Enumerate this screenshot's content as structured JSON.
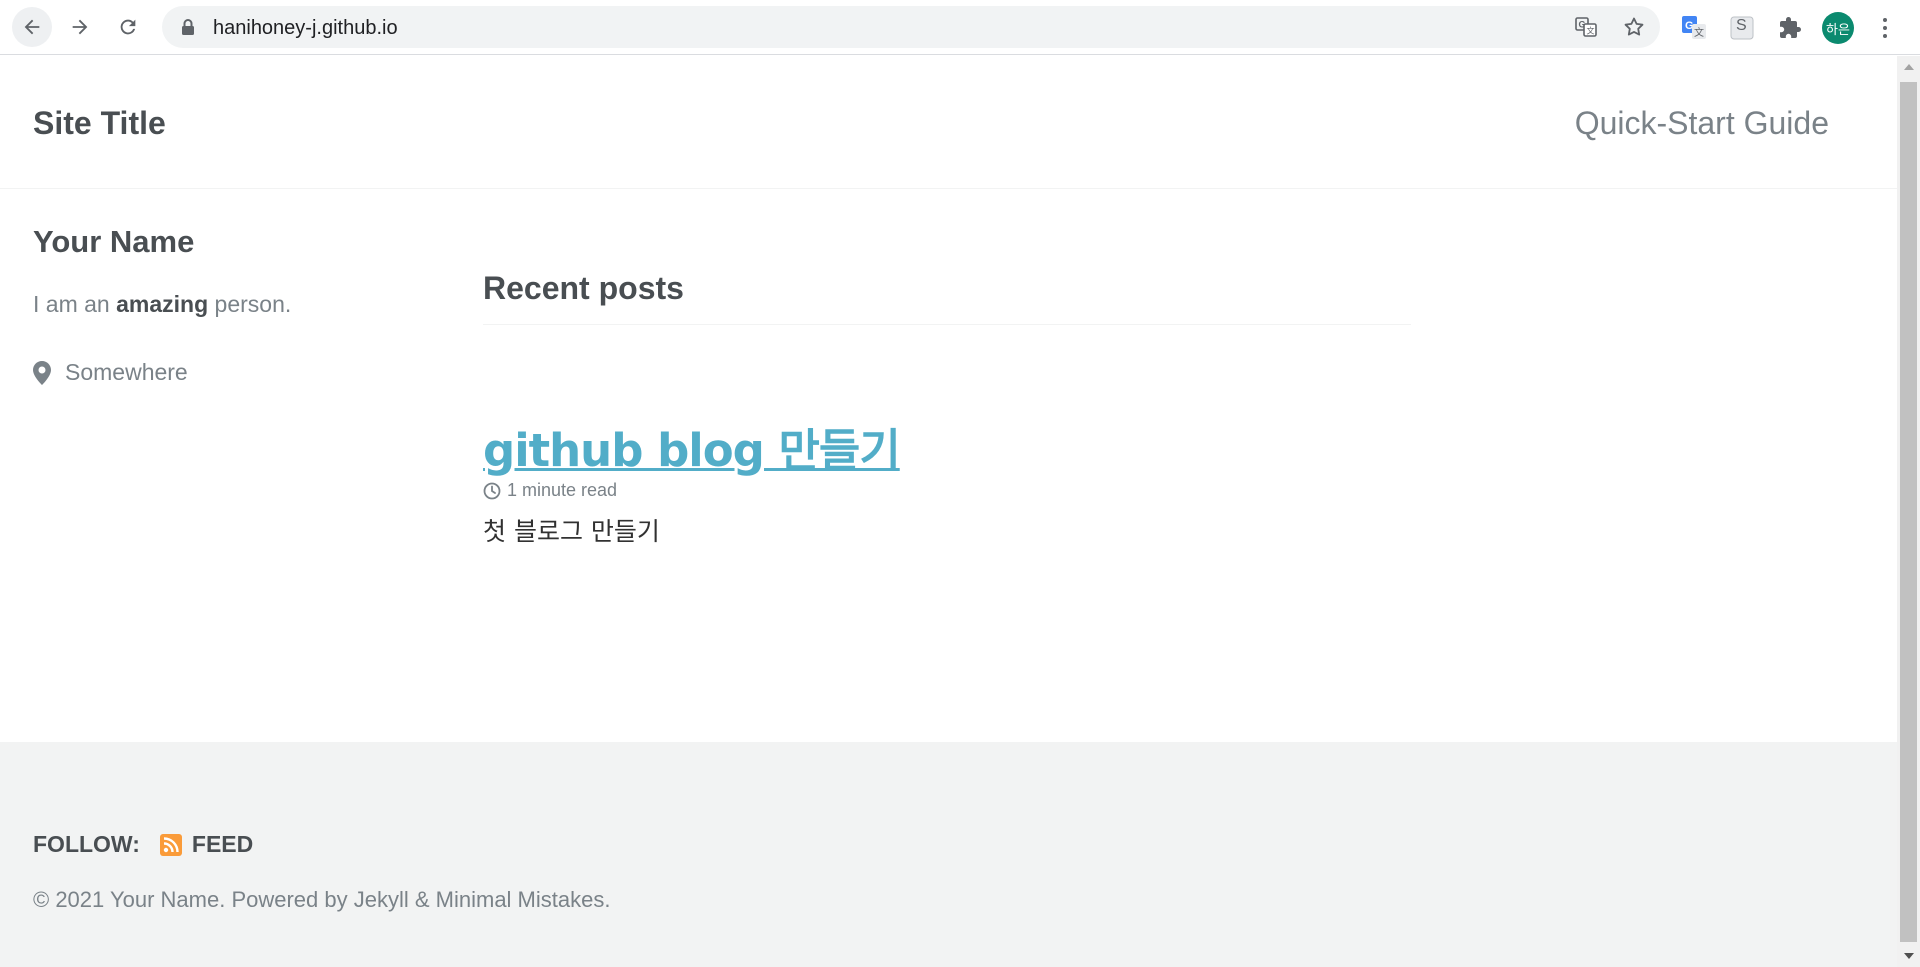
{
  "browser": {
    "url": "hanihoney-j.github.io",
    "profile_initials": "하은",
    "icons": [
      "back-icon",
      "forward-icon",
      "reload-icon",
      "lock-icon",
      "translate-icon",
      "star-icon",
      "google-translate-icon",
      "s-extension-icon",
      "extensions-icon",
      "menu-icon"
    ],
    "s_extension_letter": "S"
  },
  "masthead": {
    "site_title": "Site Title",
    "nav_link": "Quick-Start Guide"
  },
  "author": {
    "name": "Your Name",
    "bio_prefix": "I am an ",
    "bio_bold": "amazing",
    "bio_suffix": " person.",
    "location": "Somewhere"
  },
  "main": {
    "section_title": "Recent posts",
    "posts": [
      {
        "title": "github blog 만들기",
        "read_time": "1 minute read",
        "excerpt": "첫 블로그 만들기"
      }
    ]
  },
  "footer": {
    "follow_label": "FOLLOW:",
    "feed_label": "FEED",
    "copyright": "© 2021 Your Name. Powered by Jekyll & Minimal Mistakes."
  },
  "colors": {
    "link": "#52adc8",
    "text": "#494e52",
    "muted": "#7a8288",
    "footer_bg": "#f2f3f3",
    "feed_icon": "#fa9b39",
    "avatar": "#0b8a6f"
  }
}
